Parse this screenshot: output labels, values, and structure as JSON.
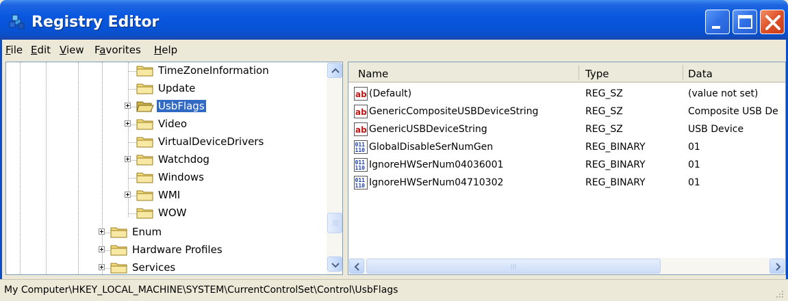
{
  "window": {
    "title": "Registry Editor"
  },
  "menu": [
    {
      "pre": "",
      "u": "F",
      "post": "ile"
    },
    {
      "pre": "",
      "u": "E",
      "post": "dit"
    },
    {
      "pre": "",
      "u": "V",
      "post": "iew"
    },
    {
      "pre": "F",
      "u": "a",
      "post": "vorites"
    },
    {
      "pre": "",
      "u": "H",
      "post": "elp"
    }
  ],
  "tree": {
    "items": [
      {
        "label": "TimeZoneInformation",
        "expandable": false,
        "selected": false
      },
      {
        "label": "Update",
        "expandable": false,
        "selected": false
      },
      {
        "label": "UsbFlags",
        "expandable": true,
        "selected": true
      },
      {
        "label": "Video",
        "expandable": true,
        "selected": false
      },
      {
        "label": "VirtualDeviceDrivers",
        "expandable": false,
        "selected": false
      },
      {
        "label": "Watchdog",
        "expandable": true,
        "selected": false
      },
      {
        "label": "Windows",
        "expandable": false,
        "selected": false
      },
      {
        "label": "WMI",
        "expandable": true,
        "selected": false
      },
      {
        "label": "WOW",
        "expandable": false,
        "selected": false
      },
      {
        "label": "Enum",
        "expandable": true,
        "selected": false
      },
      {
        "label": "Hardware Profiles",
        "expandable": true,
        "selected": false
      },
      {
        "label": "Services",
        "expandable": true,
        "selected": false
      }
    ]
  },
  "list": {
    "columns": [
      "Name",
      "Type",
      "Data"
    ],
    "rows": [
      {
        "icon": "string-value-icon",
        "name": "(Default)",
        "type": "REG_SZ",
        "data": "(value not set)"
      },
      {
        "icon": "string-value-icon",
        "name": "GenericCompositeUSBDeviceString",
        "type": "REG_SZ",
        "data": "Composite USB De"
      },
      {
        "icon": "string-value-icon",
        "name": "GenericUSBDeviceString",
        "type": "REG_SZ",
        "data": "USB Device"
      },
      {
        "icon": "binary-value-icon",
        "name": "GlobalDisableSerNumGen",
        "type": "REG_BINARY",
        "data": "01"
      },
      {
        "icon": "binary-value-icon",
        "name": "IgnoreHWSerNum04036001",
        "type": "REG_BINARY",
        "data": "01"
      },
      {
        "icon": "binary-value-icon",
        "name": "IgnoreHWSerNum04710302",
        "type": "REG_BINARY",
        "data": "01"
      }
    ]
  },
  "status": {
    "path": "My Computer\\HKEY_LOCAL_MACHINE\\SYSTEM\\CurrentControlSet\\Control\\UsbFlags"
  },
  "colors": {
    "titlebar": "#0a58e0",
    "selection": "#316ac5",
    "close": "#df5128"
  }
}
